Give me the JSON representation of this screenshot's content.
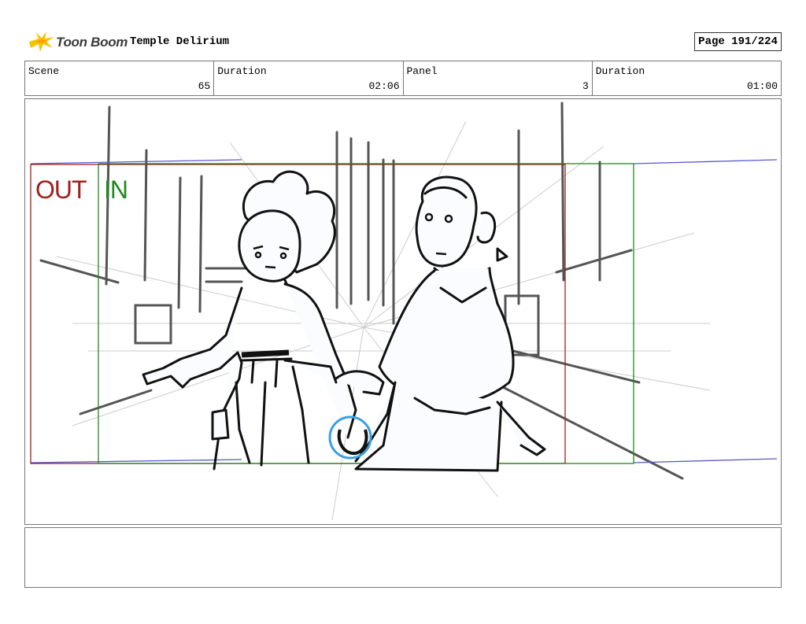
{
  "header": {
    "brand": "Toon Boom",
    "project_title": "Temple Delirium",
    "page_label": "Page 191/224"
  },
  "info": [
    {
      "label": "Scene",
      "value": "65"
    },
    {
      "label": "Duration",
      "value": "02:06"
    },
    {
      "label": "Panel",
      "value": "3"
    },
    {
      "label": "Duration",
      "value": "01:00"
    }
  ],
  "panel": {
    "out_label": "OUT",
    "in_label": "IN",
    "colors": {
      "out": "#a01e1e",
      "in": "#1e8a1e",
      "ring": "#3aa0e0",
      "guide": "#5a5ad0"
    }
  },
  "notes": {
    "text": ""
  }
}
